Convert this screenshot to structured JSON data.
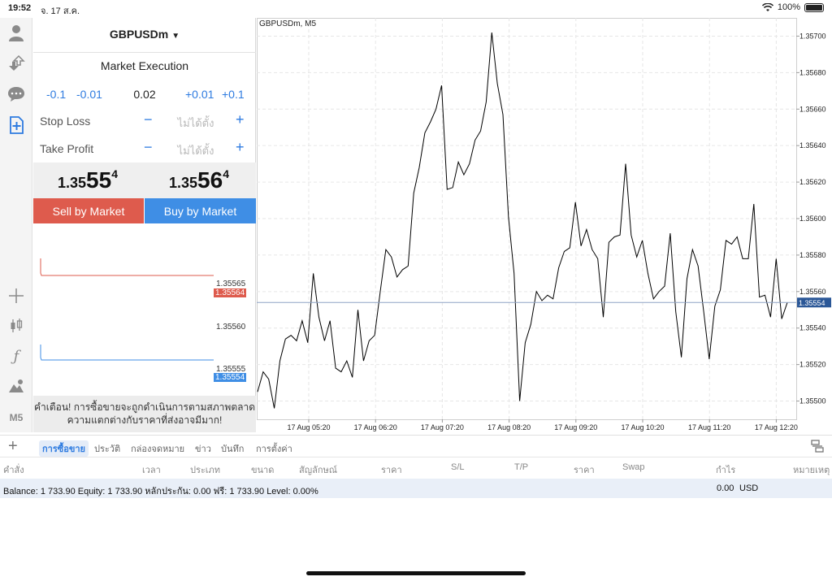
{
  "status_bar": {
    "time": "19:52",
    "date": "จ. 17 ส.ค.",
    "battery": "100%"
  },
  "order_panel": {
    "symbol": "GBPUSDm",
    "execution": "Market Execution",
    "volume_buttons": [
      "-0.1",
      "-0.01",
      "+0.01",
      "+0.1"
    ],
    "volume": "0.02",
    "stop_loss": {
      "label": "Stop Loss",
      "value": "ไม่ได้ตั้ง"
    },
    "take_profit": {
      "label": "Take Profit",
      "value": "ไม่ได้ตั้ง"
    },
    "bid": {
      "prefix": "1.35",
      "big": "55",
      "sup": "4"
    },
    "ask": {
      "prefix": "1.35",
      "big": "56",
      "sup": "4"
    },
    "sell_label": "Sell by Market",
    "buy_label": "Buy by Market",
    "mini_chart": {
      "ask_level": "1.35564",
      "ask_top": "1.35565",
      "mid": "1.35560",
      "bid_level": "1.35554",
      "bid_top": "1.35555"
    },
    "warning": "คำเตือน! การซื้อขายจะถูกดำเนินการตามสภาพตลาด ความแตกต่างกับราคาที่ส่งอาจมีมาก!"
  },
  "left_toolbar": {
    "timeframe": "M5"
  },
  "chart": {
    "title": "GBPUSDm, M5",
    "current_price": "1.35554",
    "colors": {
      "line": "#000000",
      "grid": "#e6e6e6",
      "price_tag": "#2b5797"
    }
  },
  "chart_data": {
    "type": "line",
    "title": "GBPUSDm, M5",
    "ylim": [
      1.3549,
      1.3571
    ],
    "y_ticks": [
      "1.35500",
      "1.35520",
      "1.35540",
      "1.35560",
      "1.35580",
      "1.35600",
      "1.35620",
      "1.35640",
      "1.35660",
      "1.35680",
      "1.35700"
    ],
    "x_ticks": [
      "17 Aug 05:20",
      "17 Aug 06:20",
      "17 Aug 07:20",
      "17 Aug 08:20",
      "17 Aug 09:20",
      "17 Aug 10:20",
      "17 Aug 11:20",
      "17 Aug 12:20"
    ],
    "current": 1.35554,
    "series": [
      {
        "values": [
          1.35505,
          1.35516,
          1.35512,
          1.35496,
          1.35522,
          1.35534,
          1.35536,
          1.35533,
          1.35544,
          1.35532,
          1.3557,
          1.35546,
          1.35533,
          1.35544,
          1.35518,
          1.35516,
          1.35522,
          1.35513,
          1.3555,
          1.35522,
          1.35533,
          1.35536,
          1.3556,
          1.35583,
          1.35579,
          1.35568,
          1.35572,
          1.35574,
          1.35614,
          1.35628,
          1.35647,
          1.35653,
          1.3566,
          1.35673,
          1.35616,
          1.35617,
          1.35631,
          1.35624,
          1.3563,
          1.35643,
          1.35648,
          1.35664,
          1.35702,
          1.35674,
          1.35657,
          1.35601,
          1.3557,
          1.355,
          1.35532,
          1.35542,
          1.3556,
          1.35555,
          1.35558,
          1.35556,
          1.35573,
          1.35582,
          1.35584,
          1.35609,
          1.35585,
          1.35594,
          1.35583,
          1.35578,
          1.35546,
          1.35587,
          1.3559,
          1.35591,
          1.3563,
          1.35591,
          1.35579,
          1.35588,
          1.3557,
          1.35556,
          1.3556,
          1.35563,
          1.35592,
          1.35549,
          1.35524,
          1.35567,
          1.35583,
          1.35574,
          1.35549,
          1.35523,
          1.35552,
          1.35561,
          1.35588,
          1.35586,
          1.3559,
          1.35578,
          1.35578,
          1.35608,
          1.35557,
          1.35558,
          1.35546,
          1.35578,
          1.35545,
          1.35554
        ]
      }
    ]
  },
  "bottom_tabs": [
    "การซื้อขาย",
    "ประวัติ",
    "กล่องจดหมาย",
    "ข่าว",
    "บันทึก",
    "การตั้งค่า"
  ],
  "table_headers": [
    "คำสั่ง",
    "เวลา",
    "ประเภท",
    "ขนาด",
    "สัญลักษณ์",
    "ราคา",
    "S/L",
    "T/P",
    "ราคา",
    "Swap",
    "กำไร",
    "หมายเหตุ"
  ],
  "balance": {
    "text": "Balance: 1 733.90 Equity: 1 733.90 หลักประกัน: 0.00 ฟรี: 1 733.90 Level: 0.00%",
    "profit": "0.00",
    "currency": "USD"
  }
}
